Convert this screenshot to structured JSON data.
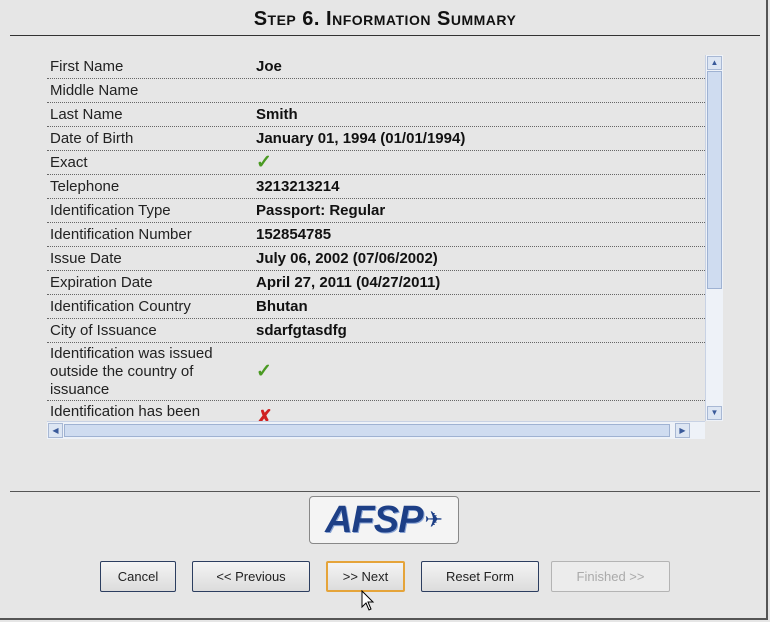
{
  "header": {
    "title": "Step 6. Information Summary"
  },
  "summary_rows": [
    {
      "label": "First Name",
      "value": "Joe"
    },
    {
      "label": "Middle Name",
      "value": ""
    },
    {
      "label": "Last Name",
      "value": "Smith"
    },
    {
      "label": "Date of Birth",
      "value": "January 01, 1994 (01/01/1994)"
    },
    {
      "label": "Exact",
      "value": "✓"
    },
    {
      "label": "Telephone",
      "value": "3213213214"
    },
    {
      "label": "Identification Type",
      "value": "Passport: Regular"
    },
    {
      "label": "Identification Number",
      "value": "152854785"
    },
    {
      "label": "Issue Date",
      "value": "July 06, 2002 (07/06/2002)"
    },
    {
      "label": "Expiration Date",
      "value": "April 27, 2011 (04/27/2011)"
    },
    {
      "label": "Identification Country",
      "value": "Bhutan"
    },
    {
      "label": "City of Issuance",
      "value": "sdarfgtasdfg"
    },
    {
      "label": "Identification was issued outside the country of issuance",
      "value": "✓"
    },
    {
      "label": "Identification has been",
      "value": "✗"
    }
  ],
  "logo": {
    "text": "AFSP",
    "icon": "airplane-icon"
  },
  "buttons": {
    "cancel": "Cancel",
    "previous": "<< Previous",
    "next": ">> Next",
    "reset": "Reset Form",
    "finished": "Finished >>"
  },
  "colors": {
    "check": "#4a9a22",
    "cross": "#d02020",
    "focus": "#e5a43a"
  }
}
